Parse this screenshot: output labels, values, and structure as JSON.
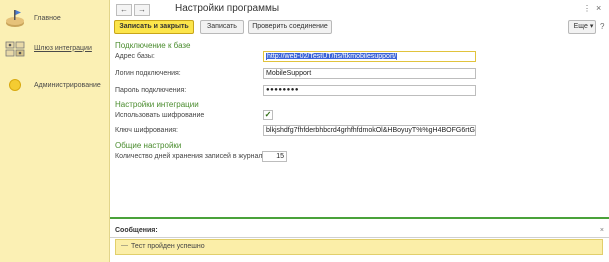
{
  "sidebar": {
    "items": [
      {
        "label": "Главное",
        "icon": "home-icon"
      },
      {
        "label": "Шлюз интеграции",
        "icon": "integration-gateway-icon"
      },
      {
        "label": "Администрирование",
        "icon": "administration-icon"
      }
    ]
  },
  "header": {
    "back": "←",
    "forward": "→",
    "title": "Настройки программы",
    "more": "⋮",
    "close": "×"
  },
  "toolbar": {
    "save_close": "Записать и закрыть",
    "save": "Записать",
    "check_connection": "Проверить соединение",
    "more": "Еще",
    "more_arrow": "▾",
    "help": "?"
  },
  "connection": {
    "section": "Подключение к базе",
    "base_url_label": "Адрес базы:",
    "base_url": "http://web-02/TestUT/hs/ftkmobilesupport/",
    "login_label": "Логин подключения:",
    "login": "MobileSupport",
    "password_label": "Пароль подключения:",
    "password": "●●●●●●●●"
  },
  "integration": {
    "section": "Настройки интеграции",
    "use_encryption_label": "Использовать шифрование",
    "use_encryption_mark": "✓",
    "key_label": "Ключ шифрования:",
    "key": "blkjshdfg7fhfderbhbcrd4grhfhfdmokOl&HBoyuyT%%gH4BOFG6rtGVF"
  },
  "general": {
    "section": "Общие настройки",
    "days_label": "Количество дней хранения записей в журнале:",
    "days": "15"
  },
  "messages": {
    "header": "Сообщения:",
    "close": "×",
    "dash": "—",
    "text": "Тест пройден успешно"
  },
  "colors": {
    "sidebar_bg": "#fbf0b4",
    "accent": "#fce54b",
    "section_green": "#4a8c2e"
  }
}
